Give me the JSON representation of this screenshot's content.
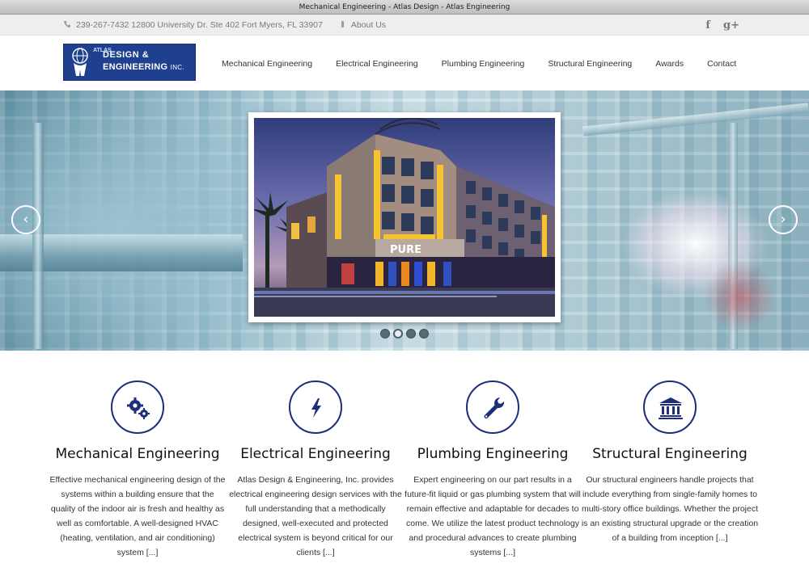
{
  "window": {
    "title": "Mechanical Engineering - Atlas Design - Atlas Engineering"
  },
  "topbar": {
    "contact": "239-267-7432 12800 University Dr. Ste 402 Fort Myers, FL 33907",
    "about": "About Us",
    "social": {
      "facebook": "f",
      "google": "g+"
    }
  },
  "logo": {
    "atlas": "ATLAS",
    "line1": "DESIGN &",
    "line2": "ENGINEERING",
    "suffix": "INC."
  },
  "nav": [
    "Mechanical Engineering",
    "Electrical Engineering",
    "Plumbing Engineering",
    "Structural Engineering",
    "Awards",
    "Contact"
  ],
  "slider": {
    "prev_icon": "‹",
    "next_icon": "›",
    "sign_text": "PURE",
    "dot_count": 4,
    "active_dot": 1
  },
  "services": [
    {
      "icon": "gears-icon",
      "title": "Mechanical Engineering",
      "text": "Effective mechanical engineering design of the systems within a building ensure that the quality of the indoor air is fresh and healthy as well as comfortable. A well-designed HVAC (heating, ventilation, and air conditioning) system [...]"
    },
    {
      "icon": "lightning-icon",
      "title": "Electrical Engineering",
      "text": "Atlas Design & Engineering, Inc. provides electrical engineering design services with the full understanding that a methodically designed, well-executed and protected electrical system is beyond critical for our clients [...]"
    },
    {
      "icon": "wrench-icon",
      "title": "Plumbing Engineering",
      "text": "Expert engineering on our part results in a future-fit liquid or gas plumbing system that will remain effective and adaptable for decades to come. We utilize the latest product technology and procedural advances to create plumbing systems [...]"
    },
    {
      "icon": "institution-icon",
      "title": "Structural Engineering",
      "text": "Our structural engineers handle projects that include everything from single-family homes to multi-story office buildings. Whether the project is an existing structural upgrade or the creation of a building from inception [...]"
    }
  ],
  "colors": {
    "brand": "#1f3f8f",
    "icon_ring": "#1f2e7a"
  }
}
